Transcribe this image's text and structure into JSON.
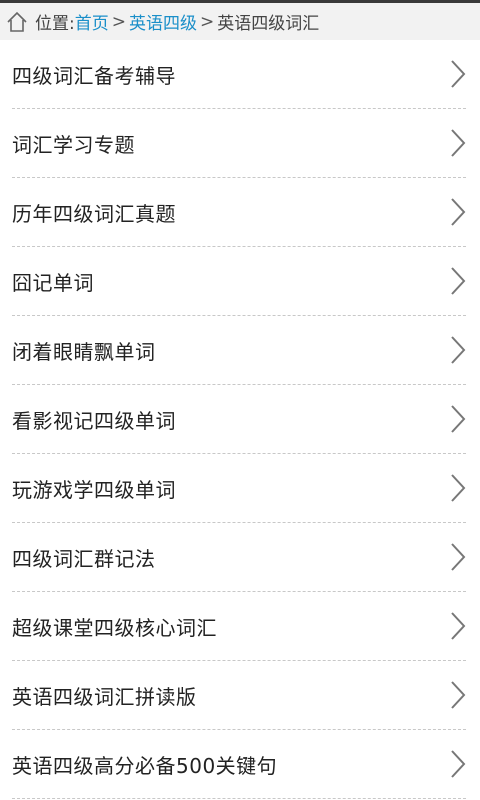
{
  "breadcrumb": {
    "prefix": "位置:",
    "links": [
      "首页",
      "英语四级"
    ],
    "separator": ">",
    "current": "英语四级词汇"
  },
  "list": {
    "items": [
      "四级词汇备考辅导",
      "词汇学习专题",
      "历年四级词汇真题",
      "囧记单词",
      "闭着眼睛飘单词",
      "看影视记四级单词",
      "玩游戏学四级单词",
      "四级词汇群记法",
      "超级课堂四级核心词汇",
      "英语四级词汇拼读版",
      "英语四级高分必备500关键句"
    ]
  },
  "icons": {
    "home": "home-icon",
    "chevron": "chevron-right-icon"
  },
  "colors": {
    "link": "#1a8fc9",
    "text": "#222222",
    "breadcrumb_bg": "#f2f2f2",
    "divider": "#c8c8c8"
  }
}
